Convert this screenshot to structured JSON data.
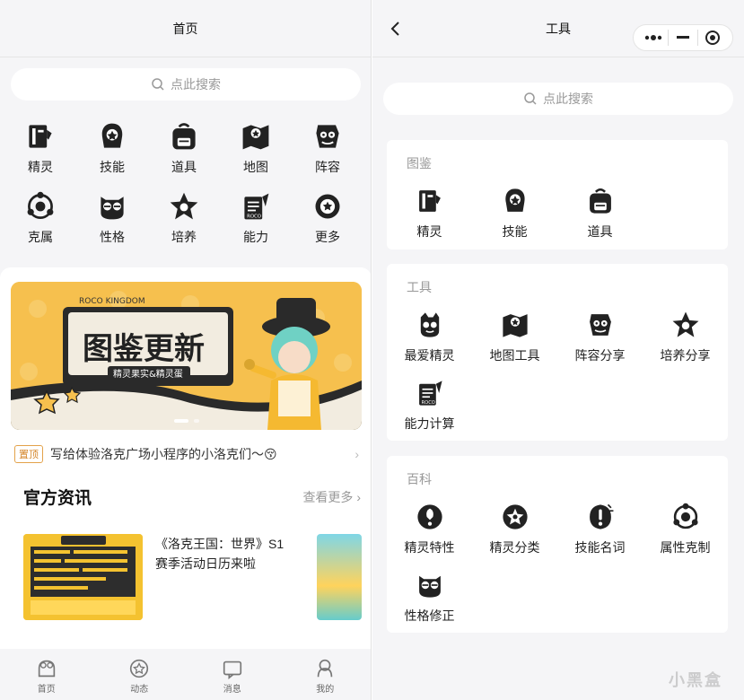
{
  "left": {
    "nav_title": "首页",
    "search_placeholder": "点此搜索",
    "grid": [
      {
        "label": "精灵",
        "icon": "book-icon"
      },
      {
        "label": "技能",
        "icon": "skill-badge-icon"
      },
      {
        "label": "道具",
        "icon": "backpack-icon"
      },
      {
        "label": "地图",
        "icon": "map-icon"
      },
      {
        "label": "阵容",
        "icon": "team-icon"
      },
      {
        "label": "克属",
        "icon": "element-cycle-icon"
      },
      {
        "label": "性格",
        "icon": "owl-icon"
      },
      {
        "label": "培养",
        "icon": "star-grow-icon"
      },
      {
        "label": "能力",
        "icon": "ability-icon"
      },
      {
        "label": "更多",
        "icon": "more-icon"
      }
    ],
    "banner": {
      "brand_top": "ROCO KINGDOM",
      "headline": "图鉴更新",
      "sub": "精灵果实&精灵蛋"
    },
    "notice": {
      "tag": "置顶",
      "text": "写给体验洛克广场小程序的小洛克们～😚"
    },
    "news": {
      "title": "官方资讯",
      "more": "查看更多",
      "item_text": "《洛克王国：世界》S1赛季活动日历来啦"
    },
    "tabs": [
      {
        "label": "首页",
        "icon": "home-icon"
      },
      {
        "label": "动态",
        "icon": "feed-icon"
      },
      {
        "label": "消息",
        "icon": "message-icon"
      },
      {
        "label": "我的",
        "icon": "profile-icon"
      }
    ]
  },
  "right": {
    "nav_title": "工具",
    "search_placeholder": "点此搜索",
    "sections": [
      {
        "title": "图鉴",
        "items": [
          {
            "label": "精灵",
            "icon": "book-icon"
          },
          {
            "label": "技能",
            "icon": "skill-badge-icon"
          },
          {
            "label": "道具",
            "icon": "backpack-icon"
          }
        ]
      },
      {
        "title": "工具",
        "items": [
          {
            "label": "最爱精灵",
            "icon": "favorite-pet-icon"
          },
          {
            "label": "地图工具",
            "icon": "map-icon"
          },
          {
            "label": "阵容分享",
            "icon": "team-icon"
          },
          {
            "label": "培养分享",
            "icon": "star-grow-icon"
          },
          {
            "label": "能力计算",
            "icon": "ability-icon"
          }
        ]
      },
      {
        "title": "百科",
        "items": [
          {
            "label": "精灵特性",
            "icon": "trait-icon"
          },
          {
            "label": "精灵分类",
            "icon": "category-icon"
          },
          {
            "label": "技能名词",
            "icon": "skill-term-icon"
          },
          {
            "label": "属性克制",
            "icon": "element-cycle-icon"
          },
          {
            "label": "性格修正",
            "icon": "owl-icon"
          }
        ]
      }
    ]
  },
  "watermark": "小黑盒",
  "colors": {
    "accent": "#f7c24d",
    "icon": "#222222",
    "bg": "#f5f5f7"
  }
}
